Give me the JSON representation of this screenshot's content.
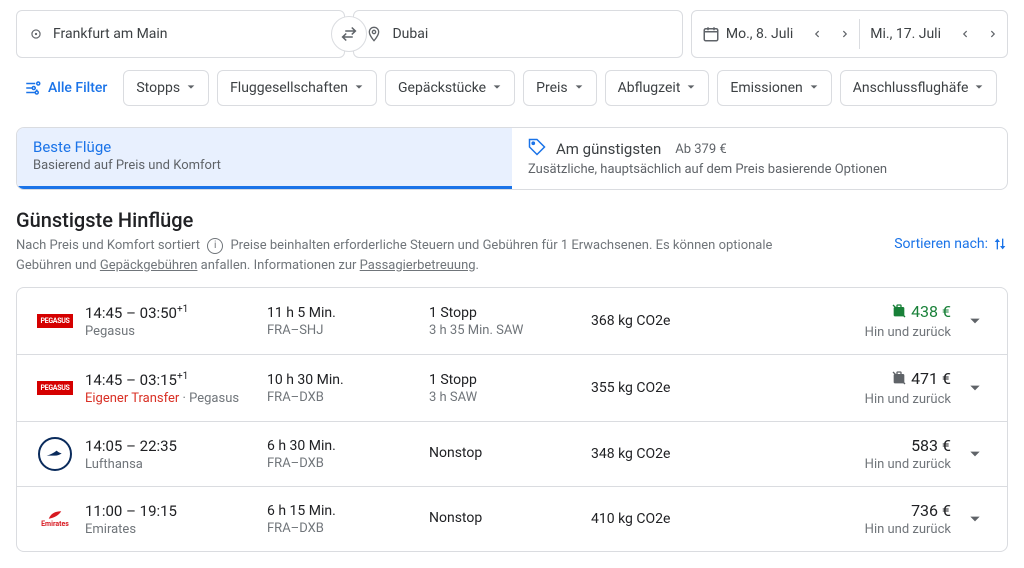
{
  "search": {
    "origin": "Frankfurt am Main",
    "destination": "Dubai",
    "depart_date": "Mo., 8. Juli",
    "return_date": "Mi., 17. Juli"
  },
  "filters": {
    "all_label": "Alle Filter",
    "chips": [
      "Stopps",
      "Fluggesellschaften",
      "Gepäckstücke",
      "Preis",
      "Abflugzeit",
      "Emissionen",
      "Anschlussflughäfe"
    ]
  },
  "tabs": {
    "best": {
      "title": "Beste Flüge",
      "subtitle": "Basierend auf Preis und Komfort"
    },
    "cheapest": {
      "title": "Am günstigsten",
      "price_hint": "Ab 379 €",
      "subtitle": "Zusätzliche, hauptsächlich auf dem Preis basierende Optionen"
    }
  },
  "section": {
    "heading": "Günstigste Hinflüge",
    "sub_prefix": "Nach Preis und Komfort sortiert",
    "sub_mid": "Preise beinhalten erforderliche Steuern und Gebühren für 1 Erwachsenen. Es können optionale Gebühren und",
    "baggage_link": "Gepäckgebühren",
    "sub_after": " anfallen. Informationen zur ",
    "passenger_link": "Passagierbetreuung",
    "sort_label": "Sortieren nach:"
  },
  "results": [
    {
      "airline_code": "pegasus",
      "times": "14:45 – 03:50",
      "dayplus": "+1",
      "carrier": "Pegasus",
      "carrier_warn": "",
      "duration": "11 h 5 Min.",
      "route": "FRA–SHJ",
      "stops": "1 Stopp",
      "layover": "3 h 35 Min. SAW",
      "co2": "368 kg CO2e",
      "price": "438 €",
      "price_green": true,
      "bag_icon": true,
      "trip_label": "Hin und zurück"
    },
    {
      "airline_code": "pegasus",
      "times": "14:45 – 03:15",
      "dayplus": "+1",
      "carrier": "Pegasus",
      "carrier_warn": "Eigener Transfer",
      "carrier_sep": " · ",
      "duration": "10 h 30 Min.",
      "route": "FRA–DXB",
      "stops": "1 Stopp",
      "layover": "3 h SAW",
      "co2": "355 kg CO2e",
      "price": "471 €",
      "price_green": false,
      "bag_icon": true,
      "trip_label": "Hin und zurück"
    },
    {
      "airline_code": "lufthansa",
      "times": "14:05 – 22:35",
      "dayplus": "",
      "carrier": "Lufthansa",
      "carrier_warn": "",
      "duration": "6 h 30 Min.",
      "route": "FRA–DXB",
      "stops": "Nonstop",
      "layover": "",
      "co2": "348 kg CO2e",
      "price": "583 €",
      "price_green": false,
      "bag_icon": false,
      "trip_label": "Hin und zurück"
    },
    {
      "airline_code": "emirates",
      "times": "11:00 – 19:15",
      "dayplus": "",
      "carrier": "Emirates",
      "carrier_warn": "",
      "duration": "6 h 15 Min.",
      "route": "FRA–DXB",
      "stops": "Nonstop",
      "layover": "",
      "co2": "410 kg CO2e",
      "price": "736 €",
      "price_green": false,
      "bag_icon": false,
      "trip_label": "Hin und zurück"
    }
  ]
}
